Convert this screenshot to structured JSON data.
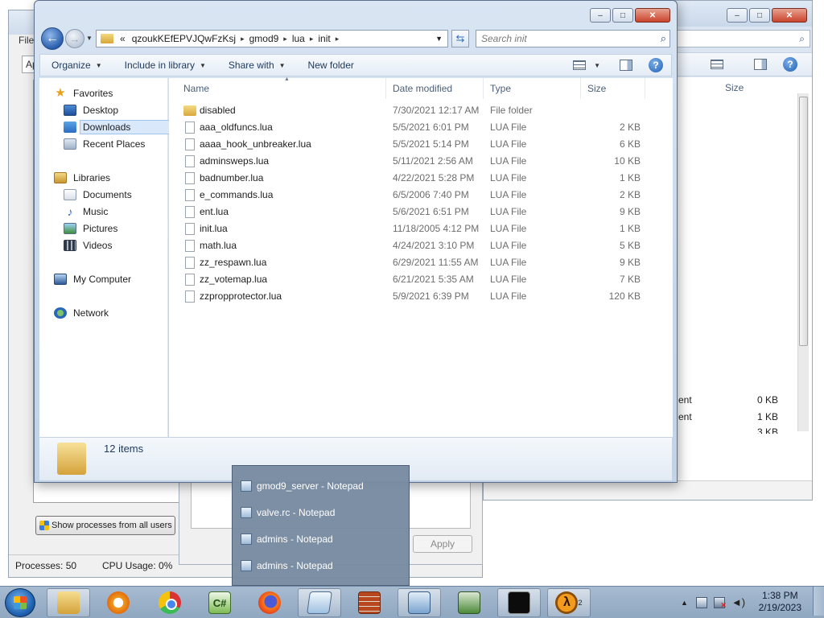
{
  "background": {
    "explorer": {
      "search_text": "⌕",
      "size_header": "Size",
      "partial_rows": [
        {
          "type_fragment": "ent",
          "size": "0 KB"
        },
        {
          "type_fragment": "ent",
          "size": "1 KB"
        },
        {
          "type_fragment": "",
          "size": "3 KB"
        }
      ]
    },
    "task_manager": {
      "menu_fragment": "File",
      "tab_fragment": "Ap",
      "show_all_label": "Show processes from all users",
      "processes_label": "Processes: 50",
      "cpu_label": "CPU Usage: 0%"
    },
    "dialog": {
      "apply_label": "Apply"
    }
  },
  "explorer": {
    "address": {
      "overflow": "«",
      "segments": [
        "qzoukKEfEPVJQwFzKsj",
        "gmod9",
        "lua",
        "init"
      ]
    },
    "search_placeholder": "Search init",
    "toolbar": {
      "organize": "Organize",
      "include": "Include in library",
      "share": "Share with",
      "new_folder": "New folder"
    },
    "nav": {
      "favorites": "Favorites",
      "desktop": "Desktop",
      "downloads": "Downloads",
      "recent": "Recent Places",
      "libraries": "Libraries",
      "documents": "Documents",
      "music": "Music",
      "pictures": "Pictures",
      "videos": "Videos",
      "computer": "My Computer",
      "network": "Network"
    },
    "columns": {
      "name": "Name",
      "date": "Date modified",
      "type": "Type",
      "size": "Size"
    },
    "files": [
      {
        "name": "disabled",
        "date": "7/30/2021 12:17 AM",
        "type": "File folder",
        "size": "",
        "is_folder": true
      },
      {
        "name": "aaa_oldfuncs.lua",
        "date": "5/5/2021 6:01 PM",
        "type": "LUA File",
        "size": "2 KB",
        "is_folder": false
      },
      {
        "name": "aaaa_hook_unbreaker.lua",
        "date": "5/5/2021 5:14 PM",
        "type": "LUA File",
        "size": "6 KB",
        "is_folder": false
      },
      {
        "name": "adminsweps.lua",
        "date": "5/11/2021 2:56 AM",
        "type": "LUA File",
        "size": "10 KB",
        "is_folder": false
      },
      {
        "name": "badnumber.lua",
        "date": "4/22/2021 5:28 PM",
        "type": "LUA File",
        "size": "1 KB",
        "is_folder": false
      },
      {
        "name": "e_commands.lua",
        "date": "6/5/2006 7:40 PM",
        "type": "LUA File",
        "size": "2 KB",
        "is_folder": false
      },
      {
        "name": "ent.lua",
        "date": "5/6/2021 6:51 PM",
        "type": "LUA File",
        "size": "9 KB",
        "is_folder": false
      },
      {
        "name": "init.lua",
        "date": "11/18/2005 4:12 PM",
        "type": "LUA File",
        "size": "1 KB",
        "is_folder": false
      },
      {
        "name": "math.lua",
        "date": "4/24/2021 3:10 PM",
        "type": "LUA File",
        "size": "5 KB",
        "is_folder": false
      },
      {
        "name": "zz_respawn.lua",
        "date": "6/29/2021 11:55 AM",
        "type": "LUA File",
        "size": "9 KB",
        "is_folder": false
      },
      {
        "name": "zz_votemap.lua",
        "date": "6/21/2021 5:35 AM",
        "type": "LUA File",
        "size": "7 KB",
        "is_folder": false
      },
      {
        "name": "zzpropprotector.lua",
        "date": "5/9/2021 6:39 PM",
        "type": "LUA File",
        "size": "120 KB",
        "is_folder": false
      }
    ],
    "status": {
      "count": "12 items"
    }
  },
  "popup": {
    "items": [
      "gmod9_server - Notepad",
      "valve.rc - Notepad",
      "admins - Notepad",
      "admins - Notepad"
    ]
  },
  "taskbar": {
    "apps": [
      "file-explorer",
      "media-player",
      "chrome",
      "csharp-ide",
      "firefox",
      "notepad",
      "firewall",
      "task-manager",
      "network-monitor",
      "command-prompt",
      "half-life-2"
    ],
    "csharp_glyph": "C#",
    "hl2_glyph": "λ",
    "hl2_badge": "2",
    "time": "1:38 PM",
    "date": "2/19/2023"
  },
  "icons": {
    "back": "←",
    "forward": "→",
    "refresh": "⇆",
    "search": "⌕",
    "help": "?",
    "minimize": "–",
    "maximize": "□",
    "close": "✕"
  },
  "colors": {
    "title_glass": "#c6d6ea",
    "selection": "#d9e8fb",
    "popup_bg": "#788aa0",
    "taskbar": "#a7bbd1"
  }
}
